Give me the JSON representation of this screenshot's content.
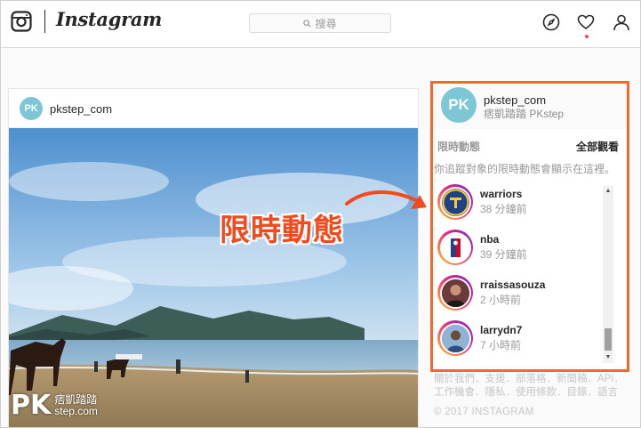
{
  "nav": {
    "brand": "Instagram",
    "search_placeholder": "搜尋",
    "icons": [
      "instagram-glyph-icon",
      "compass-icon",
      "heart-icon",
      "person-icon"
    ],
    "notification_dot_color": "#ed4956"
  },
  "post": {
    "username": "pkstep_com",
    "avatar_text": "PK"
  },
  "overlay": {
    "callout": "限時動態",
    "callout_color": "#f24a1d",
    "watermark_logo": "PK",
    "watermark_name": "痞凱踏踏",
    "watermark_site": "step.com"
  },
  "sidebar": {
    "account": {
      "username": "pkstep_com",
      "full_name": "痞凱踏踏 PKstep",
      "avatar_text": "PK"
    },
    "stories": {
      "title": "限時動態",
      "see_all": "全部觀看",
      "hint": "你追蹤對象的限時動態會顯示在這裡。",
      "items": [
        {
          "name": "warriors",
          "time": "38 分鐘前",
          "color": "#1d428a"
        },
        {
          "name": "nba",
          "time": "39 分鐘前",
          "color": "#c9082a"
        },
        {
          "name": "rraissasouza",
          "time": "2 小時前",
          "color": "#4a2a2a"
        },
        {
          "name": "larrydn7",
          "time": "7 小時前",
          "color": "#5a7fa8"
        }
      ]
    },
    "footer": {
      "links": "關於我們．支援．部落格．新聞稿．API．工作機會．隱私．使用條款．目錄．語言",
      "copyright": "© 2017 INSTAGRAM"
    },
    "highlight_color": "#f26a2c"
  }
}
